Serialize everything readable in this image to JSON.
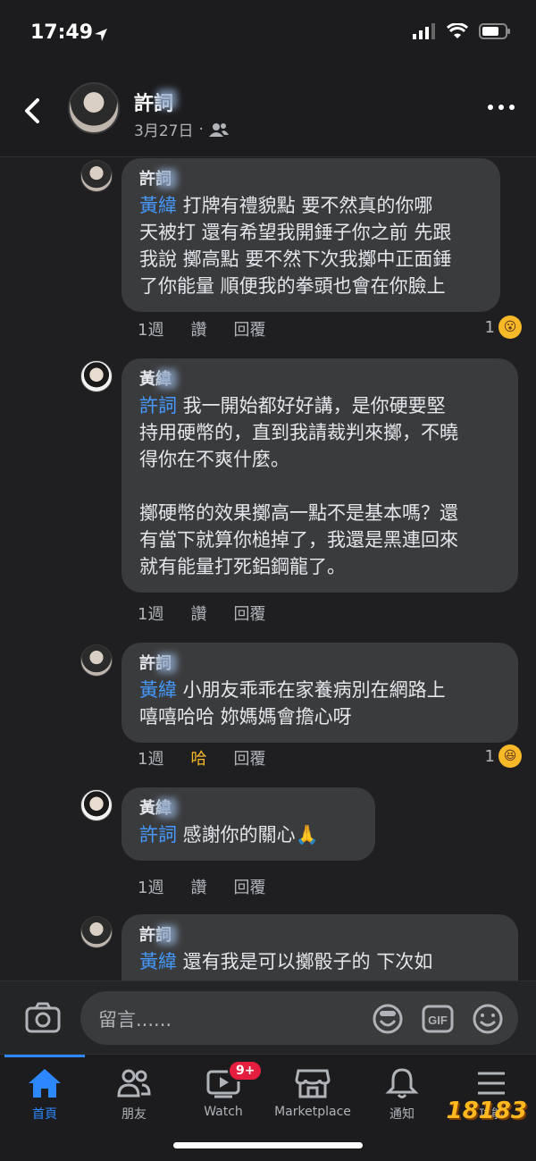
{
  "status": {
    "time": "17:49"
  },
  "header": {
    "name": "許詞",
    "date": "3月27日",
    "visibility_icon": "friends-icon"
  },
  "comments": [
    {
      "name": "許詞",
      "mention": "黃緯",
      "text": " 打牌有禮貌點 要不然真的你哪\n天被打 還有希望我開錘子你之前 先跟\n我說 擲高點 要不然下次我擲中正面錘\n了你能量 順便我的拳頭也會在你臉上",
      "time": "1週",
      "like": "讚",
      "reply": "回覆",
      "reaction_count": "1",
      "reaction": "wow"
    },
    {
      "name": "黃緯",
      "mention": "許詞",
      "text": " 我一開始都好好講，是你硬要堅\n持用硬幣的，直到我請裁判來擲，不曉\n得你在不爽什麼。\n\n擲硬幣的效果擲高一點不是基本嗎？還\n有當下就算你槌掉了，我還是黑連回來\n就有能量打死鋁鋼龍了。",
      "time": "1週",
      "like": "讚",
      "reply": "回覆"
    },
    {
      "name": "許詞",
      "mention": "黃緯",
      "text": " 小朋友乖乖在家養病別在網路上\n嘻嘻哈哈 妳媽媽會擔心呀",
      "time": "1週",
      "like": "哈",
      "reply": "回覆",
      "reaction_count": "1",
      "reaction": "haha"
    },
    {
      "name": "黃緯",
      "mention": "許詞",
      "text": " 感謝你的關心🙏",
      "time": "1週",
      "like": "讚",
      "reply": "回覆"
    },
    {
      "name": "許詞",
      "mention": "黃緯",
      "text": " 還有我是可以擲骰子的 下次如",
      "time": "",
      "like": "",
      "reply": ""
    }
  ],
  "input": {
    "placeholder": "留言......"
  },
  "tabs": [
    {
      "label": "首頁",
      "icon": "home-icon"
    },
    {
      "label": "朋友",
      "icon": "friends-icon"
    },
    {
      "label": "Watch",
      "icon": "watch-icon",
      "badge": "9+"
    },
    {
      "label": "Marketplace",
      "icon": "marketplace-icon"
    },
    {
      "label": "通知",
      "icon": "bell-icon"
    },
    {
      "label": "功能",
      "icon": "menu-icon"
    }
  ],
  "watermark": "18183",
  "colors": {
    "accent": "#2d88ff",
    "mention": "#4599ff",
    "bubble": "#3a3b3c",
    "badge": "#e41e3f",
    "laugh": "#f7b928"
  }
}
